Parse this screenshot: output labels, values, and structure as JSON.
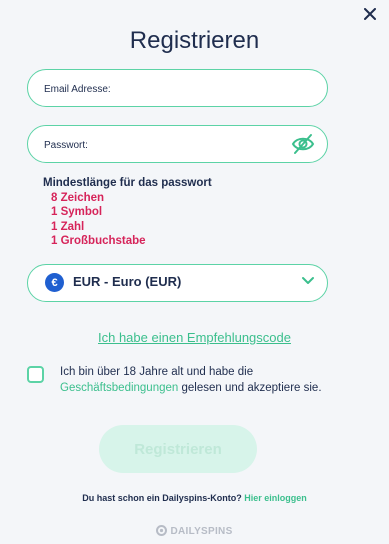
{
  "dialog": {
    "title": "Registrieren",
    "close_icon": "close-icon"
  },
  "form": {
    "email_placeholder": "Email Adresse:",
    "email_value": "",
    "password_placeholder": "Passwort:",
    "password_value": "",
    "password_toggle_icon": "eye-slash-icon"
  },
  "password_requirements": {
    "heading": "Mindestlänge für das passwort",
    "items": [
      "8 Zeichen",
      "1 Symbol",
      "1 Zahl",
      "1 Großbuchstabe"
    ],
    "item_color": "#d6245a"
  },
  "currency": {
    "symbol": "€",
    "selected": "EUR - Euro (EUR)",
    "chevron_icon": "chevron-down-icon"
  },
  "referral_link": "Ich habe einen Empfehlungscode",
  "terms": {
    "checked": false,
    "text_before": "Ich bin über 18 Jahre alt und habe die",
    "link": "Geschäftsbedingungen",
    "text_after": "gelesen und akzeptiere sie."
  },
  "submit_label": "Registrieren",
  "login": {
    "question": "Du hast schon ein Dailyspins-Konto?",
    "link": "Hier einloggen"
  },
  "brand": "DAILYSPINS",
  "colors": {
    "accent": "#5cd3a6",
    "link": "#3bbf8d",
    "text": "#1f2d4e",
    "background": "#f4f6f9"
  }
}
